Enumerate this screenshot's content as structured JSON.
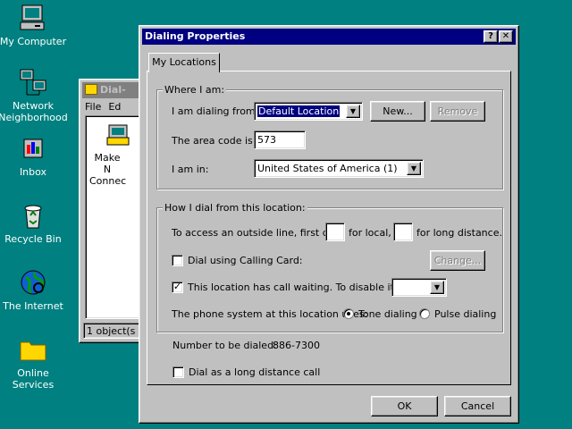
{
  "desktop": {
    "icons": [
      {
        "label": "My Computer",
        "name": "my-computer-icon"
      },
      {
        "label": "Network Neighborhood",
        "name": "network-icon"
      },
      {
        "label": "Inbox",
        "name": "inbox-icon"
      },
      {
        "label": "Recycle Bin",
        "name": "recycle-bin-icon"
      },
      {
        "label": "The Internet",
        "name": "internet-icon"
      },
      {
        "label": "Online Services",
        "name": "folder-icon"
      }
    ],
    "background": "#008080"
  },
  "bg_window": {
    "title": "Dial-",
    "menu": [
      "File",
      "Ed"
    ],
    "item_label": "Make N Connec",
    "status": "1 object(s"
  },
  "dialog": {
    "title": "Dialing Properties",
    "help_btn": "?",
    "close_btn": "✕",
    "tab": "My Locations",
    "where": {
      "legend": "Where I am:",
      "dialing_from_label": "I am dialing from:",
      "dialing_from_value": "Default Location",
      "new_btn": "New...",
      "remove_btn": "Remove",
      "area_code_label": "The area code is:",
      "area_code_value": "573",
      "am_in_label": "I am in:",
      "am_in_value": "United States of America (1)"
    },
    "how": {
      "legend": "How I dial from this location:",
      "outside_line_label": "To access an outside line, first dial:",
      "local_label": "for local,",
      "long_label": "for long distance.",
      "local_value": "",
      "long_value": "",
      "calling_card_label": "Dial using Calling Card:",
      "change_btn": "Change...",
      "call_waiting_label": "This location has call waiting. To disable it, dial:",
      "call_waiting_value": "",
      "phone_system_label": "The phone system at this location uses:",
      "tone_label": "Tone dialing",
      "pulse_label": "Pulse dialing"
    },
    "number_label": "Number to be dialed:",
    "number_value": "886-7300",
    "long_distance_label": "Dial as a long distance call",
    "ok_btn": "OK",
    "cancel_btn": "Cancel",
    "state": {
      "calling_card_checked": false,
      "call_waiting_checked": true,
      "tone_selected": true,
      "long_distance_checked": false
    }
  }
}
